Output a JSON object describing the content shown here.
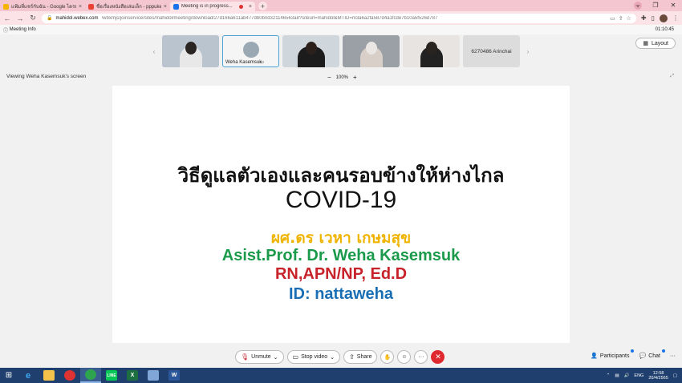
{
  "browser": {
    "tabs": [
      {
        "title": "แฟ้มที่แชร์กับฉัน - Google ไดรฟ์",
        "favicon_color": "#f4b400",
        "active": false
      },
      {
        "title": "ชื่อเรื่องหนังสือเล่มเล็ก - pppukermm@g",
        "favicon_color": "#ea4335",
        "active": false
      },
      {
        "title": "Meeting is in progress...",
        "favicon_color": "#1a73e8",
        "active": true
      }
    ],
    "new_tab": "+",
    "url_host": "mahidol.webex.com",
    "url_path": "/wbxmjs/joinservice/sites/mahidol/meeting/download/27d166a611ab477db0b0d321146563a8?siteurl=mahidol&MTID=m3a6a2fa587d4a1fcde7b10a5f526d787"
  },
  "meeting": {
    "info_label": "Meeting Info",
    "timer": "01:10:45",
    "layout_label": "Layout",
    "viewing_label": "Viewing Weha Kasemsuk's screen",
    "zoom_minus": "−",
    "zoom_level": "100%",
    "zoom_plus": "+",
    "participants_strip": [
      {
        "type": "video",
        "label": "",
        "bg": "#b9c4cf",
        "shirt": "#e8e8e8"
      },
      {
        "type": "avatar",
        "label": "Weha Kasemsuk",
        "bg": "#f5f5f5",
        "shirt": "#7d8c99"
      },
      {
        "type": "video",
        "label": "",
        "bg": "#cfd6dc",
        "shirt": "#1c1c1c"
      },
      {
        "type": "video",
        "label": "",
        "bg": "#9aa0a6",
        "shirt": "#d8d0c8"
      },
      {
        "type": "video",
        "label": "",
        "bg": "#e7e4e1",
        "shirt": "#222222"
      },
      {
        "type": "name",
        "label": "6270486 Arinchai",
        "bg": "#dcdcdc",
        "shirt": ""
      }
    ]
  },
  "slide": {
    "title_th": "วิธีดูแลตัวเองและคนรอบข้างให้ห่างไกล",
    "title_en": "COVID-19",
    "presenter_th": "ผศ.ดร เวหา เกษมสุข",
    "presenter_en": "Asist.Prof. Dr. Weha Kasemsuk",
    "credentials": "RN,APN/NP, Ed.D",
    "id_line": "ID: nattaweha"
  },
  "controls": {
    "unmute": "Unmute",
    "stop_video": "Stop video",
    "share": "Share",
    "participants": "Participants",
    "chat": "Chat",
    "more": "···"
  },
  "taskbar": {
    "lang": "ENG",
    "time": "12:58",
    "date": "20/4/2565"
  }
}
